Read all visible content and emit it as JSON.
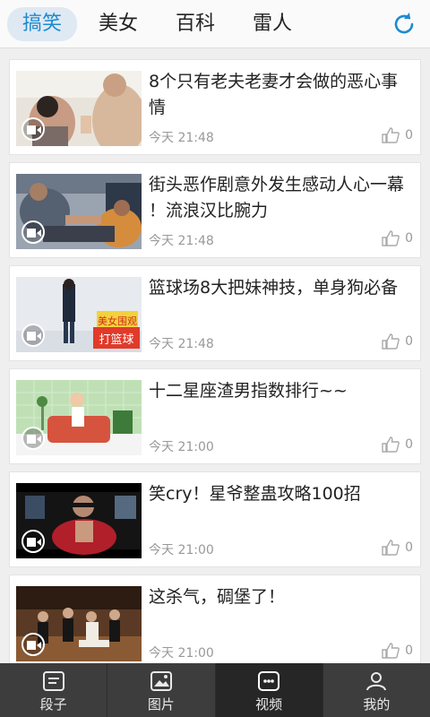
{
  "tabs": [
    {
      "label": "搞笑",
      "active": true
    },
    {
      "label": "美女",
      "active": false
    },
    {
      "label": "百科",
      "active": false
    },
    {
      "label": "雷人",
      "active": false
    }
  ],
  "refresh_icon": "refresh-icon",
  "accent_color": "#1d8bd0",
  "feed": [
    {
      "title": "8个只有老夫老妻才会做的恶心事情",
      "time": "今天 21:48",
      "likes": "0"
    },
    {
      "title": "街头恶作剧意外发生感动人心一幕 ！流浪汉比腕力",
      "time": "今天 21:48",
      "likes": "0"
    },
    {
      "title": "篮球场8大把妹神技，单身狗必备",
      "time": "今天 21:48",
      "likes": "0",
      "thumb_caption_1": "美女围观",
      "thumb_caption_2": "打篮球"
    },
    {
      "title": "十二星座渣男指数排行~~",
      "time": "今天 21:00",
      "likes": "0"
    },
    {
      "title": "笑cry！星爷整蛊攻略100招",
      "time": "今天 21:00",
      "likes": "0"
    },
    {
      "title": "这杀气，碉堡了！",
      "time": "今天 21:00",
      "likes": "0"
    }
  ],
  "bottom_nav": [
    {
      "label": "段子",
      "icon": "jokes-icon",
      "active": false
    },
    {
      "label": "图片",
      "icon": "image-icon",
      "active": false
    },
    {
      "label": "视频",
      "icon": "video-icon",
      "active": true
    },
    {
      "label": "我的",
      "icon": "profile-icon",
      "active": false
    }
  ]
}
